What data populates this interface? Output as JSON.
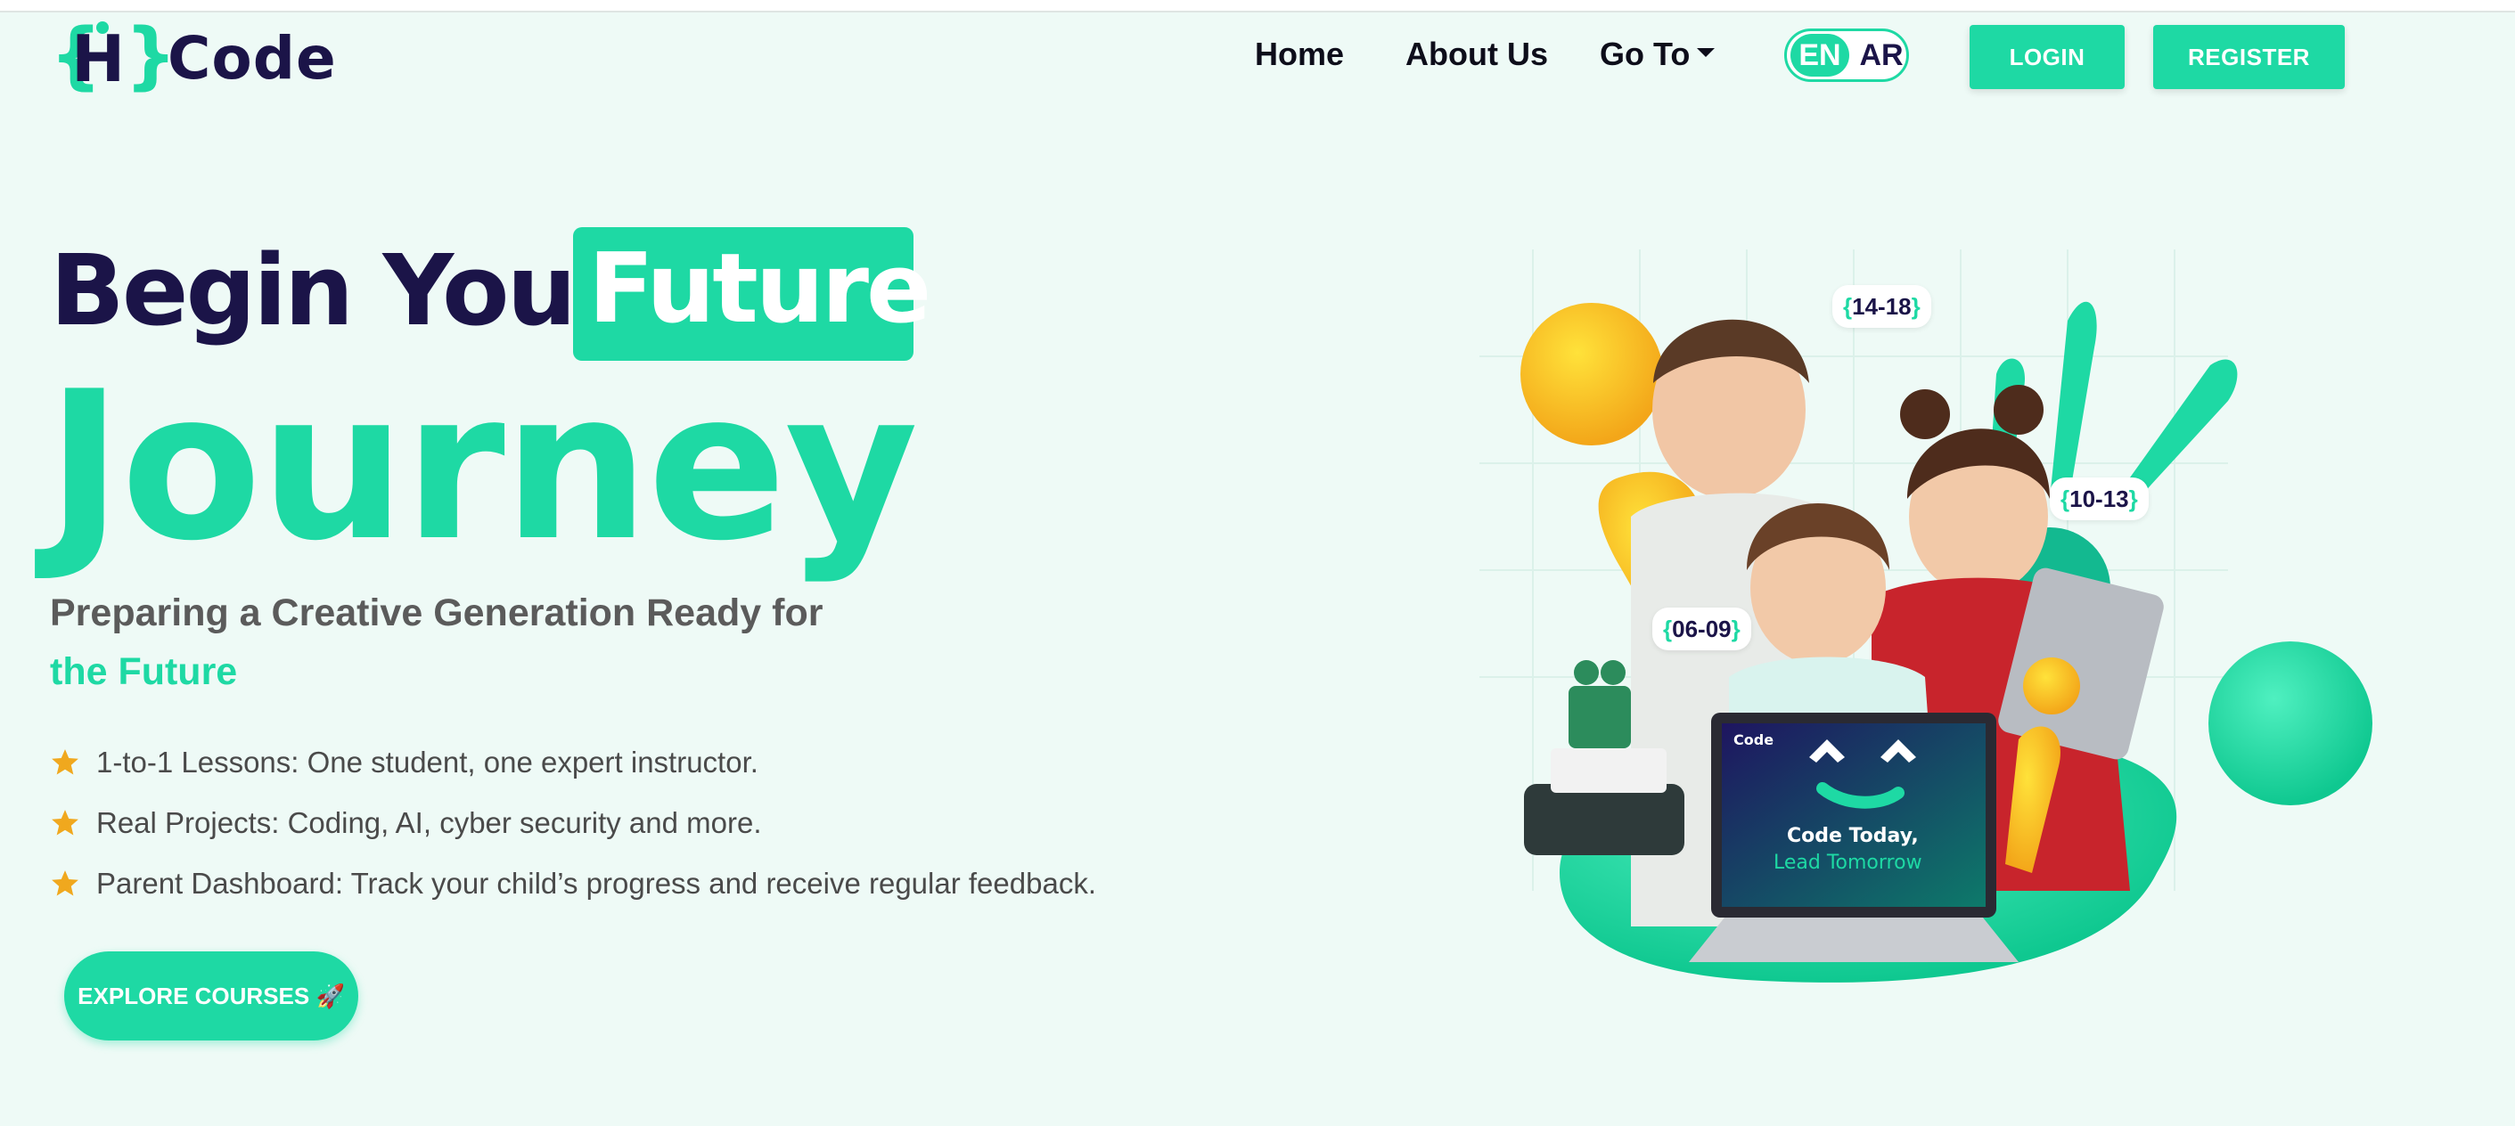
{
  "header": {
    "logo_text": "Code",
    "nav": {
      "home": "Home",
      "about": "About Us",
      "goto": "Go To"
    },
    "lang": {
      "en": "EN",
      "ar": "AR"
    },
    "login": "LOGIN",
    "register": "REGISTER"
  },
  "hero": {
    "title_part1": "Begin Your",
    "title_highlight": "Future",
    "title_line2": "Journey",
    "subtitle_line1": "Preparing a Creative Generation Ready for",
    "subtitle_line2": "the Future",
    "features": [
      "1-to-1 Lessons: One student, one expert instructor.",
      "Real Projects: Coding, AI, cyber security and more.",
      "Parent Dashboard: Track your child’s progress and receive regular feedback."
    ],
    "cta": "EXPLORE COURSES 🚀"
  },
  "illustration": {
    "age_tags": [
      "14-18",
      "10-13",
      "06-09"
    ],
    "laptop_brand": "Code",
    "laptop_line1": "Code Today,",
    "laptop_line2": "Lead Tomorrow"
  },
  "colors": {
    "accent": "#1ed9a4",
    "navy": "#1b1448",
    "background": "#eefaf6",
    "star": "#f0a81e"
  }
}
